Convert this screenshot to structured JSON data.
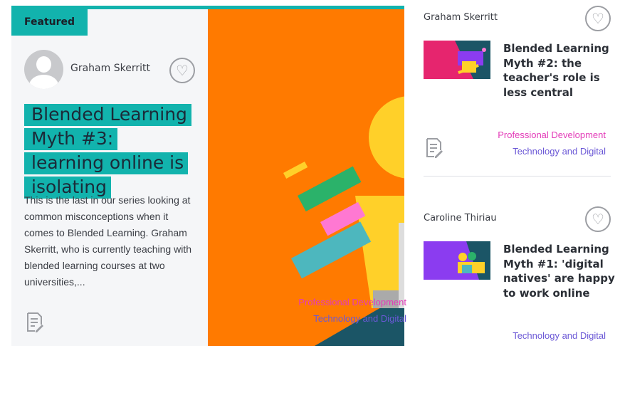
{
  "featured": {
    "badge": "Featured",
    "author": "Graham Skerritt",
    "title": "Blended Learning Myth #3: learning online is isolating",
    "excerpt": "This is the last in our series looking at common misconceptions when it comes to Blended Learning. Graham Skerritt, who is currently teaching with blended learning courses at two universities,...",
    "tags": [
      "Professional Development",
      "Technology and Digital"
    ],
    "colors": {
      "accent": "#12b3ad",
      "hero": "#ff7a00",
      "tag_pink": "#e33bb8",
      "tag_blue": "#6b58d6"
    }
  },
  "side_articles": [
    {
      "author": "Graham Skerritt",
      "title": "Blended Learning Myth #2: the teacher's role is less central",
      "tags": [
        "Professional Development",
        "Technology and Digital"
      ]
    },
    {
      "author": "Caroline Thiriau",
      "title": "Blended Learning Myth #1: 'digital natives' are happy to work online",
      "tags": [
        "Technology and Digital"
      ]
    }
  ],
  "icons": {
    "favourite": "heart-icon",
    "article": "document-icon",
    "avatar": "default-avatar-icon"
  }
}
